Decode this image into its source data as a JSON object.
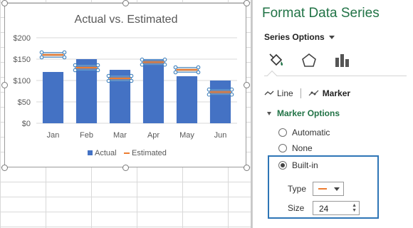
{
  "chart": {
    "title": "Actual vs. Estimated",
    "legend": {
      "actual": "Actual",
      "estimated": "Estimated"
    }
  },
  "chart_data": {
    "type": "bar",
    "title": "Actual vs. Estimated",
    "categories": [
      "Jan",
      "Feb",
      "Mar",
      "Apr",
      "May",
      "Jun"
    ],
    "series": [
      {
        "name": "Actual",
        "type": "bar",
        "color": "#4472c4",
        "values": [
          120,
          150,
          125,
          150,
          110,
          100
        ]
      },
      {
        "name": "Estimated",
        "type": "marker-dash",
        "color": "#ed7d31",
        "values": [
          160,
          130,
          105,
          143,
          125,
          73
        ]
      }
    ],
    "ylim": [
      0,
      200
    ],
    "yticks": [
      "$0",
      "$50",
      "$100",
      "$150",
      "$200"
    ],
    "grid": true,
    "legend_position": "bottom"
  },
  "pane": {
    "title": "Format Data Series",
    "series_options_label": "Series Options",
    "tab_icons": [
      "paint-bucket-icon",
      "pentagon-effects-icon",
      "bar-chart-options-icon"
    ],
    "subtabs": {
      "line": "Line",
      "marker": "Marker"
    },
    "marker_options_header": "Marker Options",
    "radios": {
      "automatic": "Automatic",
      "none": "None",
      "builtin": "Built-in"
    },
    "selected_radio": "Built-in",
    "type_label": "Type",
    "size_label": "Size",
    "size_value": "24",
    "accent": "#217346",
    "highlight": "#2e75b6"
  }
}
